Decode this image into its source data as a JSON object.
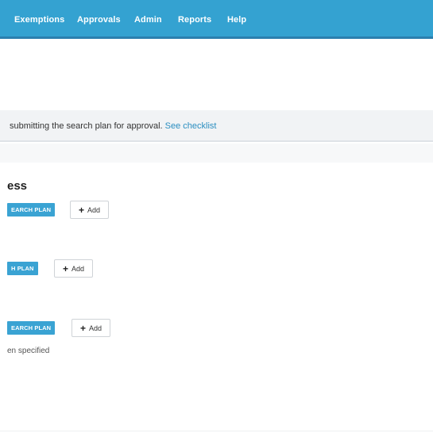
{
  "nav": {
    "items": [
      {
        "label": "Exemptions"
      },
      {
        "label": "Approvals"
      },
      {
        "label": "Admin"
      },
      {
        "label": "Reports"
      },
      {
        "label": "Help"
      }
    ]
  },
  "notice": {
    "text": "submitting the search plan for approval.",
    "link": "See checklist"
  },
  "section": {
    "title": "ess"
  },
  "plans": [
    {
      "badge": "EARCH PLAN",
      "add_label": "Add"
    },
    {
      "badge": "H PLAN",
      "add_label": "Add"
    },
    {
      "badge": "EARCH PLAN",
      "add_label": "Add",
      "status": "en specified"
    }
  ]
}
